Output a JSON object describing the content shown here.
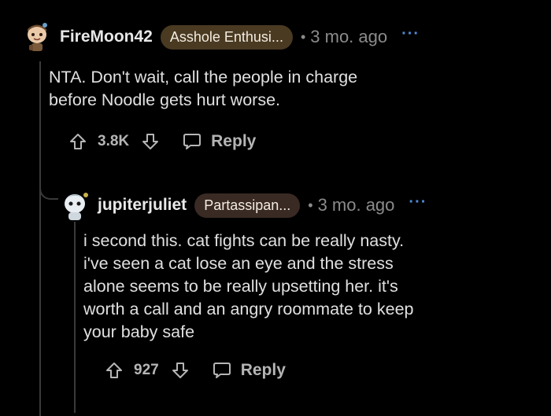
{
  "comments": [
    {
      "username": "FireMoon42",
      "flair": "Asshole Enthusi...",
      "separator": "•",
      "time": "3 mo. ago",
      "more": "···",
      "body": "NTA. Don't wait, call the people in charge\nbefore Noodle gets hurt worse.",
      "score": "3.8K",
      "reply_label": "Reply",
      "avatar_icon": "snoo-avatar-icon"
    },
    {
      "username": "jupiterjuliet",
      "flair": "Partassipan...",
      "separator": "•",
      "time": "3 mo. ago",
      "more": "···",
      "body": "i second this. cat fights can be really nasty.\ni've seen a cat lose an eye and the stress\nalone seems to be really upsetting her. it's\nworth a call and an angry roommate to keep\nyour baby safe",
      "score": "927",
      "reply_label": "Reply",
      "avatar_icon": "snoo-avatar-icon"
    }
  ],
  "colors": {
    "background": "#000000",
    "flair_1": "#4a3a22",
    "flair_2": "#3a2a24",
    "meta": "#8b8b8b",
    "more_dots": "#4f8cd9"
  }
}
